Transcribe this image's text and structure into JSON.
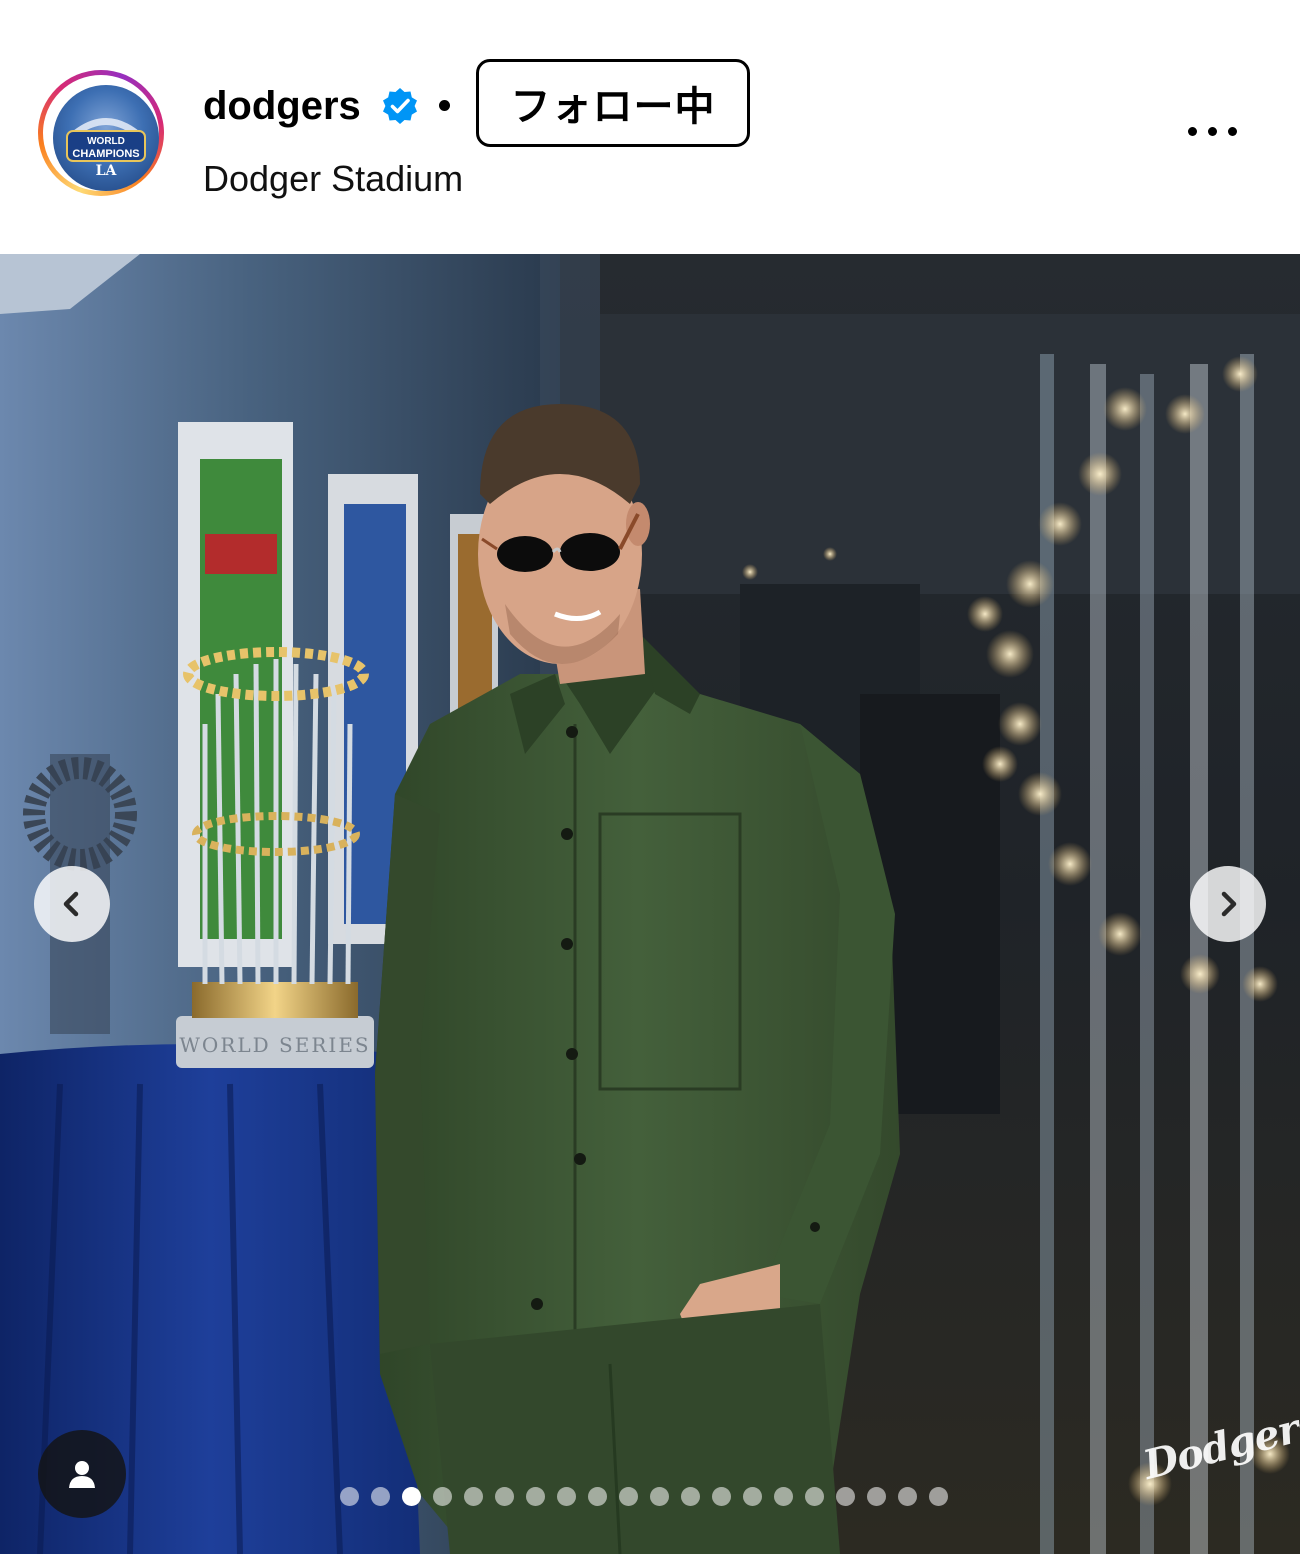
{
  "post_header": {
    "username": "dodgers",
    "verified": true,
    "follow_button_label": "フォロー中",
    "location": "Dodger Stadium",
    "more_icon": "more-horizontal-icon",
    "avatar_badge_text": "WORLD CHAMPIONS"
  },
  "photo": {
    "slide_count": 20,
    "active_slide_index": 2,
    "watermark": "Dodgers",
    "prev_icon": "chevron-left-icon",
    "next_icon": "chevron-right-icon",
    "tag_icon": "person-tag-icon"
  },
  "colors": {
    "verified_blue": "#0095f6",
    "shirt_green": "#3f5a37",
    "tablecloth_blue": "#1d3a8a"
  }
}
